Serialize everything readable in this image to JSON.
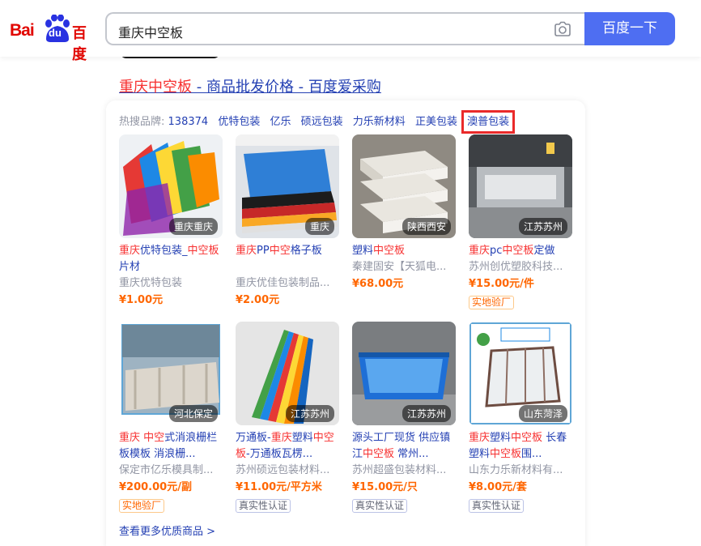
{
  "logo": {
    "bai": "Bai",
    "du": "du",
    "cn": "百度"
  },
  "search": {
    "query": "重庆中空板",
    "button": "百度一下"
  },
  "result": {
    "title_hl": "重庆中空板",
    "title_rest": " - 商品批发价格 - 百度爱采购"
  },
  "brands": {
    "label": "热搜品牌:",
    "items": [
      "138374",
      "优特包装",
      "亿乐",
      "硕远包装",
      "力乐新材料",
      "正美包装",
      "澳普包装"
    ]
  },
  "products": [
    {
      "hl1": "重庆",
      "t1": "优特包装_",
      "hl2": "中空板",
      "t2": "片材",
      "shop": "重庆优特包装",
      "price": "¥1.00元",
      "tag": "",
      "location": "重庆重庆"
    },
    {
      "hl1": "重庆",
      "t1": "PP",
      "hl2": "中空",
      "t2": "格子板",
      "shop": "重庆优佳包装制品...",
      "price": "¥2.00元",
      "tag": "",
      "location": "重庆"
    },
    {
      "hl1": "",
      "t1": "塑料",
      "hl2": "中空板",
      "t2": "",
      "shop": "秦建固安【天狐电...",
      "price": "¥68.00元",
      "tag": "",
      "location": "陕西西安"
    },
    {
      "hl1": "重庆",
      "t1": "pc",
      "hl2": "中空板",
      "t2": "定做",
      "shop": "苏州创优塑胶科技...",
      "price": "¥15.00元/件",
      "tag": "实地验厂",
      "location": "江苏苏州"
    },
    {
      "hl1": "重庆 中空",
      "t1": "式消浪栅栏板模板 消浪栅...",
      "hl2": "",
      "t2": "",
      "shop": "保定市亿乐模具制...",
      "price": "¥200.00元/副",
      "tag": "实地验厂",
      "location": "河北保定"
    },
    {
      "hl1": "",
      "t1": "万通板-",
      "hl2": "重庆",
      "t2": "塑料",
      "hl3": "中空板",
      "t3": "-万通板瓦楞...",
      "shop": "苏州硕远包装材料...",
      "price": "¥11.00元/平方米",
      "tag": "真实性认证",
      "location": "江苏苏州"
    },
    {
      "hl1": "",
      "t1": "源头工厂现货 供应镇江",
      "hl2": "中空板",
      "t2": " 常州...",
      "shop": "苏州超盛包装材料...",
      "price": "¥15.00元/只",
      "tag": "真实性认证",
      "location": "江苏苏州"
    },
    {
      "hl1": "重庆",
      "t1": "塑料",
      "hl2": "中空板",
      "t2": " 长春塑料",
      "hl3": "中空板",
      "t3": "围...",
      "shop": "山东力乐新材料有...",
      "price": "¥8.00元/套",
      "tag": "真实性认证",
      "location": "山东菏泽"
    }
  ],
  "more": "查看更多优质商品 >",
  "colors": {
    "accent": "#4e6ef2",
    "link": "#2440b3",
    "highlight": "#f73131",
    "price": "#ff6600",
    "box": "#ea2a2a"
  }
}
